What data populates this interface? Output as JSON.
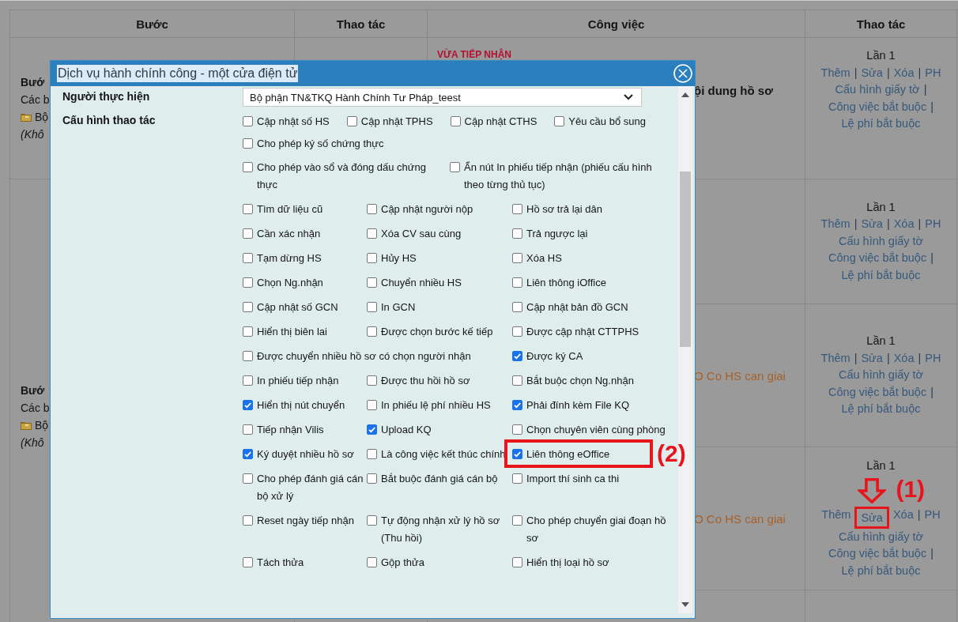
{
  "table": {
    "columns": [
      "Bước",
      "Thao tác",
      "Công việc",
      "Thao tác"
    ],
    "steps": [
      {
        "lines": [
          {
            "text": "Bướ",
            "kind": "title"
          },
          {
            "text": "Các b",
            "kind": "plain"
          },
          {
            "text": "Bộ",
            "kind": "unit"
          },
          {
            "text": "(Khô",
            "kind": "note"
          }
        ],
        "rows": [
          {
            "task": [
              {
                "text": "VỪA TIẾP NHẬN",
                "kind": "status"
              },
              {
                "text": "ội dung hồ sơ",
                "kind": "title"
              }
            ],
            "actions": {
              "count": "Lần 1",
              "lines": [
                [
                  {
                    "text": "Thêm",
                    "kind": "link"
                  },
                  {
                    "text": "|",
                    "kind": "sep"
                  },
                  {
                    "text": "Sửa",
                    "kind": "link"
                  },
                  {
                    "text": "|",
                    "kind": "sep"
                  },
                  {
                    "text": "Xóa",
                    "kind": "link"
                  },
                  {
                    "text": "|",
                    "kind": "sep"
                  },
                  {
                    "text": "PH",
                    "kind": "link"
                  }
                ],
                [
                  {
                    "text": "Cấu hình giấy tờ",
                    "kind": "link"
                  },
                  {
                    "text": "|",
                    "kind": "sep"
                  }
                ],
                [
                  {
                    "text": "Công việc bắt buộc",
                    "kind": "link"
                  },
                  {
                    "text": "|",
                    "kind": "sep"
                  }
                ],
                [
                  {
                    "text": "Lệ phí bắt buộc",
                    "kind": "link"
                  }
                ]
              ]
            }
          }
        ]
      },
      {
        "lines": [
          {
            "text": "Bướ",
            "kind": "title"
          },
          {
            "text": "Các b",
            "kind": "plain"
          },
          {
            "text": "Bộ",
            "kind": "unit"
          },
          {
            "text": "(Khô",
            "kind": "note"
          }
        ],
        "rows": [
          {
            "actions": {
              "count": "Lần 1",
              "lines": [
                [
                  {
                    "text": "Thêm",
                    "kind": "link"
                  },
                  {
                    "text": "|",
                    "kind": "sep"
                  },
                  {
                    "text": "Sửa",
                    "kind": "link"
                  },
                  {
                    "text": "|",
                    "kind": "sep"
                  },
                  {
                    "text": "Xóa",
                    "kind": "link"
                  },
                  {
                    "text": "|",
                    "kind": "sep"
                  },
                  {
                    "text": "PH",
                    "kind": "link"
                  }
                ],
                [
                  {
                    "text": "Cấu hình giấy tờ",
                    "kind": "link"
                  }
                ],
                [
                  {
                    "text": "Công việc bắt buộc",
                    "kind": "link"
                  },
                  {
                    "text": "|",
                    "kind": "sep"
                  }
                ],
                [
                  {
                    "text": "Lệ phí bắt buộc",
                    "kind": "link"
                  }
                ]
              ]
            }
          },
          {
            "task": [
              {
                "text": "O Co HS can giai",
                "kind": "tag"
              }
            ],
            "actions": {
              "count": "Lần 1",
              "lines": [
                [
                  {
                    "text": "Thêm",
                    "kind": "link"
                  },
                  {
                    "text": "|",
                    "kind": "sep"
                  },
                  {
                    "text": "Sửa",
                    "kind": "link"
                  },
                  {
                    "text": "|",
                    "kind": "sep"
                  },
                  {
                    "text": "Xóa",
                    "kind": "link"
                  },
                  {
                    "text": "|",
                    "kind": "sep"
                  },
                  {
                    "text": "PH",
                    "kind": "link"
                  }
                ],
                [
                  {
                    "text": "Cấu hình giấy tờ",
                    "kind": "link"
                  }
                ],
                [
                  {
                    "text": "Công việc bắt buộc",
                    "kind": "link"
                  },
                  {
                    "text": "|",
                    "kind": "sep"
                  }
                ],
                [
                  {
                    "text": "Lệ phí bắt buộc",
                    "kind": "link"
                  }
                ]
              ]
            }
          },
          {
            "task": [
              {
                "text": "O Co HS can giai",
                "kind": "tag"
              }
            ],
            "actions": {
              "count": "Lần 1",
              "lines": [
                [
                  {
                    "text": "Thêm",
                    "kind": "link"
                  },
                  {
                    "text": "Sửa",
                    "kind": "link",
                    "callout": "(1)"
                  },
                  {
                    "text": "Xóa",
                    "kind": "link"
                  },
                  {
                    "text": "|",
                    "kind": "sep"
                  },
                  {
                    "text": "PH",
                    "kind": "link"
                  }
                ],
                [
                  {
                    "text": "Cấu hình giấy tờ",
                    "kind": "link"
                  }
                ],
                [
                  {
                    "text": "Công việc bắt buộc",
                    "kind": "link"
                  },
                  {
                    "text": "|",
                    "kind": "sep"
                  }
                ],
                [
                  {
                    "text": "Lệ phí bắt buộc",
                    "kind": "link"
                  }
                ]
              ]
            }
          },
          {}
        ]
      }
    ]
  },
  "dialog": {
    "title": "Dịch vụ hành chính công - một cửa điện tử",
    "performer": {
      "label": "Người thực hiện",
      "value": "Bộ phận TN&TKQ Hành Chính Tư Pháp_teest"
    },
    "config_label": "Cấu hình thao tác",
    "option_rows": [
      {
        "kind": "flow",
        "options": [
          {
            "label": "Cập nhật số HS",
            "checked": false
          },
          {
            "label": "Cập nhật TPHS",
            "checked": false
          },
          {
            "label": "Cập nhật CTHS",
            "checked": false
          },
          {
            "label": "Yêu cầu bổ sung",
            "checked": false
          }
        ]
      },
      {
        "kind": "flow",
        "options": [
          {
            "label": "Cho phép ký số chứng thực",
            "checked": false
          }
        ]
      },
      {
        "kind": "pair",
        "options": [
          {
            "label": "Cho phép vào sổ và đóng dấu chứng thực",
            "checked": false
          },
          {
            "label": "Ẩn nút In phiếu tiếp nhận (phiếu cấu hình theo từng thủ tục)",
            "checked": false
          }
        ]
      },
      {
        "kind": "grid",
        "options": [
          {
            "label": "Tìm dữ liệu cũ",
            "checked": false
          },
          {
            "label": "Cập nhật người nộp",
            "checked": false
          },
          {
            "label": "Hồ sơ trả lại dân",
            "checked": false
          }
        ]
      },
      {
        "kind": "grid",
        "options": [
          {
            "label": "Cần xác nhận",
            "checked": false
          },
          {
            "label": "Xóa CV sau cùng",
            "checked": false
          },
          {
            "label": "Trả ngược lại",
            "checked": false
          }
        ]
      },
      {
        "kind": "grid",
        "options": [
          {
            "label": "Tạm dừng HS",
            "checked": false
          },
          {
            "label": "Hủy HS",
            "checked": false
          },
          {
            "label": "Xóa HS",
            "checked": false
          }
        ]
      },
      {
        "kind": "grid",
        "options": [
          {
            "label": "Chọn Ng.nhận",
            "checked": false
          },
          {
            "label": "Chuyển nhiều HS",
            "checked": false
          },
          {
            "label": "Liên thông iOffice",
            "checked": false
          }
        ]
      },
      {
        "kind": "grid",
        "options": [
          {
            "label": "Cập nhật số GCN",
            "checked": false
          },
          {
            "label": "In GCN",
            "checked": false
          },
          {
            "label": "Cập nhật bản đồ GCN",
            "checked": false
          }
        ]
      },
      {
        "kind": "grid",
        "options": [
          {
            "label": "Hiển thị biên lai",
            "checked": false
          },
          {
            "label": "Được chọn bước kế tiếp",
            "checked": false
          },
          {
            "label": "Được cập nhật CTTPHS",
            "checked": false
          }
        ]
      },
      {
        "kind": "grid",
        "options": [
          {
            "label": "Được chuyển nhiều hồ sơ có chọn người nhận",
            "checked": false
          },
          {
            "label": "Được ký CA",
            "checked": true
          }
        ]
      },
      {
        "kind": "grid",
        "options": [
          {
            "label": "In phiếu tiếp nhận",
            "checked": false
          },
          {
            "label": "Được thu hồi hồ sơ",
            "checked": false
          },
          {
            "label": "Bắt buộc chọn Ng.nhận",
            "checked": false
          }
        ]
      },
      {
        "kind": "grid",
        "options": [
          {
            "label": "Hiển thị nút chuyển",
            "checked": true
          },
          {
            "label": "In phiếu lệ phí nhiều HS",
            "checked": false
          },
          {
            "label": "Phải đính kèm File KQ",
            "checked": true
          }
        ]
      },
      {
        "kind": "grid",
        "options": [
          {
            "label": "Tiếp nhận Vilis",
            "checked": false
          },
          {
            "label": "Upload KQ",
            "checked": true
          },
          {
            "label": "Chọn chuyên viên cùng phòng",
            "checked": false
          }
        ]
      },
      {
        "kind": "grid",
        "options": [
          {
            "label": "Ký duyệt nhiều hồ sơ",
            "checked": true
          },
          {
            "label": "Là công việc kết thúc chính",
            "checked": false
          },
          {
            "label": "Liên thông eOffice",
            "checked": true,
            "callout": "(2)"
          }
        ]
      },
      {
        "kind": "grid",
        "options": [
          {
            "label": "Cho phép đánh giá cán bộ xử lý",
            "checked": false
          },
          {
            "label": "Bắt buộc đánh giá cán bộ",
            "checked": false
          },
          {
            "label": "Import thí sinh ca thi",
            "checked": false
          }
        ]
      },
      {
        "kind": "grid",
        "options": [
          {
            "label": "Reset ngày tiếp nhận",
            "checked": false
          },
          {
            "label": "Tự động nhận xử lý hồ sơ (Thu hồi)",
            "checked": false
          },
          {
            "label": "Cho phép chuyển giai đoạn hồ sơ",
            "checked": false
          }
        ]
      },
      {
        "kind": "grid",
        "options": [
          {
            "label": "Tách thửa",
            "checked": false
          },
          {
            "label": "Gộp thửa",
            "checked": false
          },
          {
            "label": "Hiển thị loại hồ sơ",
            "checked": false
          }
        ]
      }
    ]
  }
}
